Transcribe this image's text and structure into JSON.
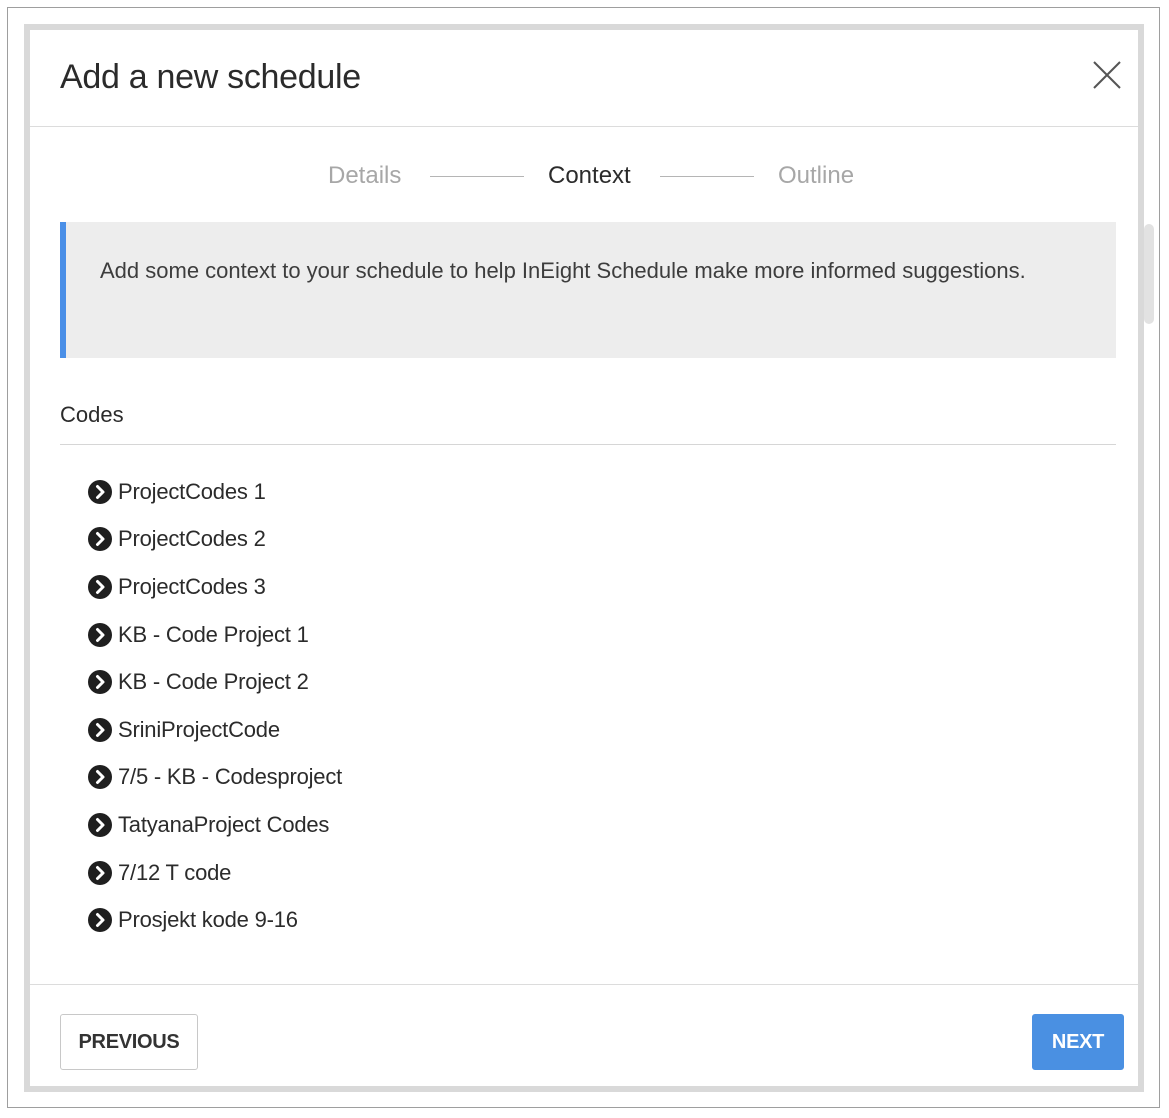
{
  "dialog": {
    "title": "Add a new schedule",
    "close_icon": "close-icon"
  },
  "stepper": {
    "steps": [
      {
        "label": "Details",
        "state": "inactive"
      },
      {
        "label": "Context",
        "state": "active"
      },
      {
        "label": "Outline",
        "state": "inactive"
      }
    ]
  },
  "info": {
    "text": "Add some context to your schedule to help InEight Schedule make more informed suggestions."
  },
  "codes": {
    "title": "Codes",
    "items": [
      "ProjectCodes 1",
      "ProjectCodes 2",
      "ProjectCodes 3",
      "KB - Code Project 1",
      "KB - Code Project 2",
      "SriniProjectCode",
      "7/5 - KB - Codesproject",
      "TatyanaProject Codes",
      "7/12 T code",
      "Prosjekt kode 9-16"
    ]
  },
  "footer": {
    "previous_label": "PREVIOUS",
    "next_label": "NEXT"
  },
  "colors": {
    "accent": "#4a90e2",
    "info_border": "#4a8fe7",
    "info_bg": "#ededed"
  }
}
